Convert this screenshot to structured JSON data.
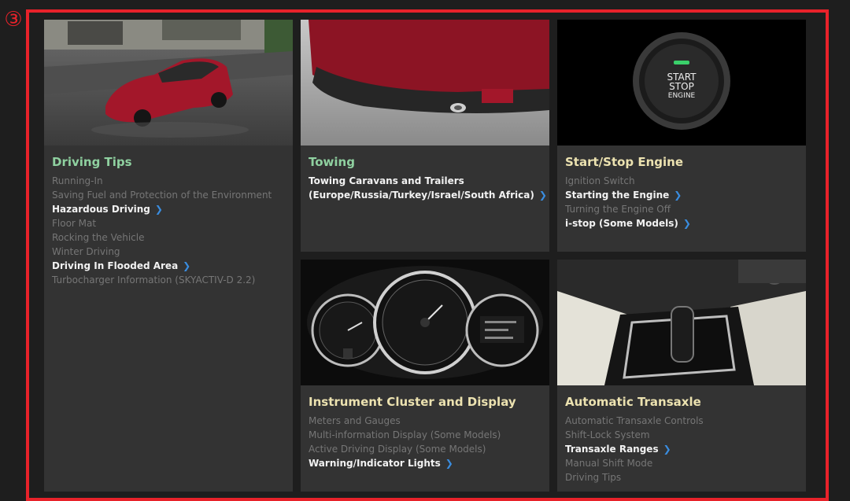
{
  "marker": "③",
  "colors": {
    "frame": "#e8222a",
    "chevron": "#3a8de0"
  },
  "cards": [
    {
      "title": "Driving Tips",
      "links": [
        {
          "label": "Running-In",
          "active": false
        },
        {
          "label": "Saving Fuel and Protection of the Environment",
          "active": false
        },
        {
          "label": "Hazardous Driving",
          "active": true
        },
        {
          "label": "Floor Mat",
          "active": false
        },
        {
          "label": "Rocking the Vehicle",
          "active": false
        },
        {
          "label": "Winter Driving",
          "active": false
        },
        {
          "label": "Driving In Flooded Area",
          "active": true
        },
        {
          "label": "Turbocharger Information (SKYACTIV-D 2.2)",
          "active": false
        }
      ]
    },
    {
      "title": "Towing",
      "links": [
        {
          "label": "Towing Caravans and Trailers",
          "active": true
        },
        {
          "label": "(Europe/Russia/Turkey/Israel/South Africa)",
          "active": true
        }
      ]
    },
    {
      "title": "Start/Stop Engine",
      "button": {
        "line1": "START",
        "line2": "STOP",
        "line3": "ENGINE"
      },
      "links": [
        {
          "label": "Ignition Switch",
          "active": false
        },
        {
          "label": "Starting the Engine",
          "active": true
        },
        {
          "label": "Turning the Engine Off",
          "active": false
        },
        {
          "label": "i-stop (Some Models)",
          "active": true
        }
      ]
    },
    {
      "title": "Instrument Cluster and Display",
      "links": [
        {
          "label": "Meters and Gauges",
          "active": false
        },
        {
          "label": "Multi-information Display (Some Models)",
          "active": false
        },
        {
          "label": "Active Driving Display (Some Models)",
          "active": false
        },
        {
          "label": "Warning/Indicator Lights",
          "active": true
        }
      ]
    },
    {
      "title": "Automatic Transaxle",
      "links": [
        {
          "label": "Automatic Transaxle Controls",
          "active": false
        },
        {
          "label": "Shift-Lock System",
          "active": false
        },
        {
          "label": "Transaxle Ranges",
          "active": true
        },
        {
          "label": "Manual Shift Mode",
          "active": false
        },
        {
          "label": "Driving Tips",
          "active": false
        }
      ]
    }
  ]
}
